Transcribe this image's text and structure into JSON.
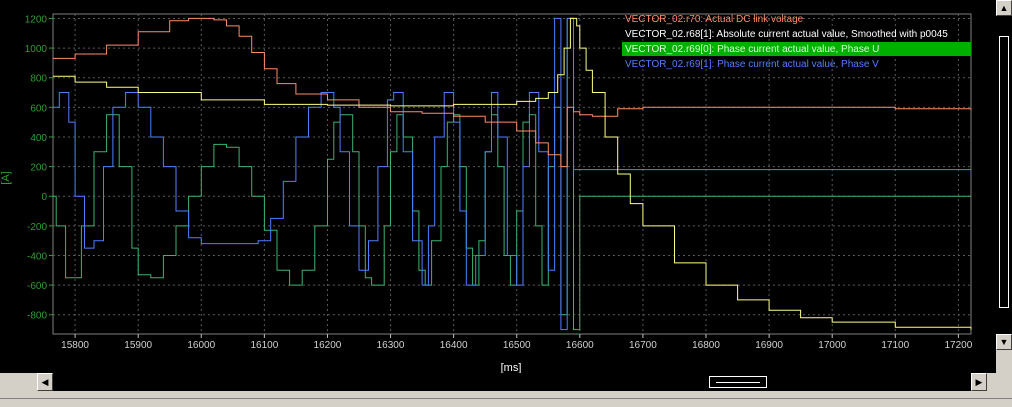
{
  "chart_data": {
    "type": "line",
    "xlabel": "[ms]",
    "ylabel": "[A]",
    "xlim": [
      15765,
      17220
    ],
    "ylim": [
      -930,
      1230
    ],
    "x_ticks": [
      15800,
      15900,
      16000,
      16100,
      16200,
      16300,
      16400,
      16500,
      16600,
      16700,
      16800,
      16900,
      17000,
      17100,
      17200
    ],
    "y_ticks": [
      -800,
      -600,
      -400,
      -200,
      0,
      200,
      400,
      600,
      800,
      1000,
      1200
    ],
    "grid": true,
    "legend_position": "top-right",
    "background": "#000000",
    "series": [
      {
        "name": "VECTOR_02.r70: Actual DC link voltage",
        "color": "#ff8c69",
        "style": "step",
        "x": [
          15765,
          15800,
          15850,
          15900,
          15950,
          15980,
          16000,
          16020,
          16040,
          16060,
          16080,
          16100,
          16120,
          16150,
          16200,
          16250,
          16300,
          16350,
          16400,
          16450,
          16500,
          16530,
          16550,
          16570,
          16580,
          16590,
          16600,
          16620,
          16640,
          16660,
          16700,
          16800,
          16900,
          17000,
          17100,
          17220
        ],
        "y": [
          930,
          960,
          1020,
          1110,
          1185,
          1200,
          1200,
          1190,
          1150,
          1080,
          970,
          860,
          760,
          690,
          650,
          600,
          570,
          560,
          540,
          500,
          440,
          360,
          280,
          200,
          600,
          570,
          550,
          540,
          540,
          590,
          600,
          600,
          600,
          600,
          590,
          580
        ]
      },
      {
        "name": "VECTOR_02.r68[1]: Absolute current actual value, Smoothed with p0045",
        "color": "#ffff80",
        "style": "step",
        "x": [
          15765,
          15800,
          15850,
          15900,
          16000,
          16100,
          16200,
          16300,
          16400,
          16500,
          16530,
          16550,
          16565,
          16575,
          16585,
          16595,
          16600,
          16610,
          16620,
          16640,
          16660,
          16680,
          16700,
          16750,
          16800,
          16850,
          16900,
          16950,
          17000,
          17100,
          17220
        ],
        "y": [
          810,
          770,
          735,
          700,
          650,
          620,
          615,
          610,
          620,
          640,
          660,
          700,
          820,
          1000,
          1200,
          1150,
          1000,
          850,
          700,
          400,
          150,
          -50,
          -200,
          -450,
          -600,
          -700,
          -770,
          -820,
          -850,
          -885,
          -900
        ]
      },
      {
        "name": "VECTOR_02.r69[0]: Phase current actual value, Phase U",
        "color": "#3cb371",
        "style": "step",
        "x": [
          15765,
          15770,
          15785,
          15800,
          15810,
          15830,
          15850,
          15870,
          15890,
          15900,
          15920,
          15940,
          15960,
          15980,
          16000,
          16020,
          16040,
          16060,
          16080,
          16100,
          16120,
          16140,
          16160,
          16180,
          16200,
          16210,
          16220,
          16240,
          16250,
          16260,
          16270,
          16290,
          16300,
          16310,
          16320,
          16335,
          16345,
          16355,
          16365,
          16380,
          16390,
          16400,
          16410,
          16420,
          16430,
          16440,
          16450,
          16460,
          16470,
          16480,
          16490,
          16500,
          16510,
          16520,
          16530,
          16540,
          16550,
          16560,
          16570,
          16580,
          16590,
          16600,
          16700,
          16800,
          16900,
          17000,
          17100,
          17220
        ],
        "y": [
          0,
          -200,
          -550,
          -550,
          -200,
          300,
          550,
          200,
          -350,
          -530,
          -550,
          -400,
          -200,
          0,
          200,
          350,
          330,
          200,
          0,
          -230,
          -500,
          -600,
          -500,
          -200,
          250,
          500,
          550,
          300,
          -200,
          -550,
          -600,
          -200,
          300,
          550,
          400,
          -100,
          -500,
          -600,
          -300,
          200,
          500,
          550,
          200,
          -350,
          -600,
          -300,
          300,
          550,
          200,
          -400,
          -600,
          -100,
          500,
          550,
          -200,
          -600,
          200,
          600,
          -800,
          1200,
          -900,
          0,
          0,
          0,
          0,
          0,
          0,
          0
        ]
      },
      {
        "name": "VECTOR_02.r69[1]: Phase current actual value, Phase V",
        "color": "#4f7fff",
        "style": "step",
        "x": [
          15765,
          15775,
          15790,
          15800,
          15815,
          15830,
          15845,
          15860,
          15880,
          15900,
          15920,
          15940,
          15960,
          15980,
          16000,
          16030,
          16060,
          16090,
          16110,
          16130,
          16150,
          16170,
          16190,
          16210,
          16220,
          16235,
          16250,
          16265,
          16280,
          16295,
          16305,
          16320,
          16335,
          16350,
          16360,
          16370,
          16385,
          16400,
          16410,
          16420,
          16435,
          16450,
          16460,
          16470,
          16485,
          16500,
          16510,
          16520,
          16535,
          16550,
          16560,
          16570,
          16580,
          16590,
          16600,
          16700,
          16800,
          16900,
          17000,
          17100,
          17220
        ],
        "y": [
          600,
          700,
          500,
          0,
          -350,
          -300,
          200,
          600,
          700,
          600,
          400,
          200,
          -100,
          -280,
          -320,
          -320,
          -320,
          -300,
          -150,
          100,
          400,
          600,
          700,
          600,
          300,
          -200,
          -500,
          -300,
          200,
          650,
          700,
          300,
          -300,
          -600,
          -200,
          400,
          700,
          500,
          -100,
          -600,
          -400,
          300,
          700,
          400,
          -400,
          -600,
          200,
          700,
          300,
          -500,
          1200,
          -900,
          1200,
          180,
          180,
          180,
          180,
          180,
          180,
          180,
          180
        ]
      }
    ]
  }
}
